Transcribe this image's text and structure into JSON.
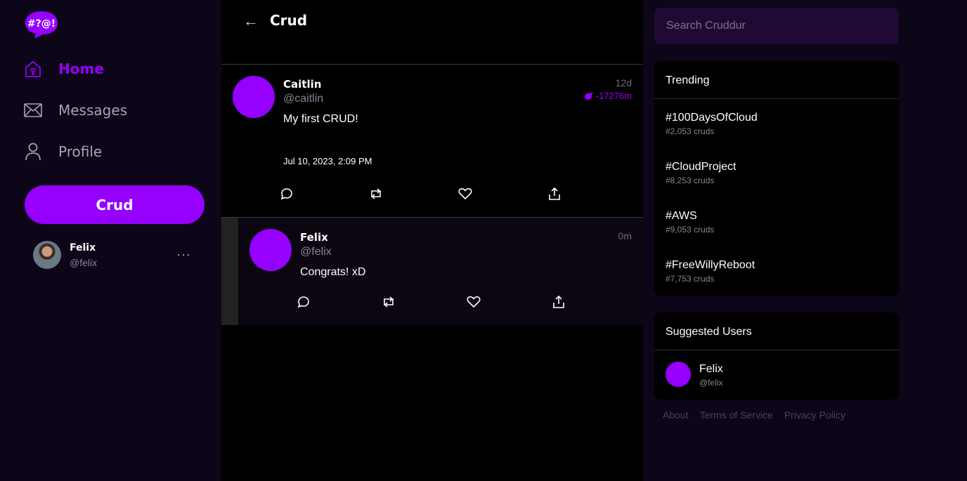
{
  "colors": {
    "accent": "#9500ff",
    "background": "#0d0518",
    "panel": "#000000"
  },
  "logo": {
    "text": "#?@!"
  },
  "nav": {
    "home": {
      "label": "Home",
      "icon": "home-icon"
    },
    "messages": {
      "label": "Messages",
      "icon": "mail-icon"
    },
    "profile": {
      "label": "Profile",
      "icon": "user-icon"
    }
  },
  "crud_button": {
    "label": "Crud"
  },
  "current_user": {
    "name": "Felix",
    "handle": "@felix",
    "more": "···"
  },
  "main": {
    "back": "←",
    "title": "Crud"
  },
  "post": {
    "name": "Caitlin",
    "handle": "@caitlin",
    "text": "My first CRUD!",
    "time": "12d",
    "expires": "-17276m",
    "date": "Jul 10, 2023, 2:09 PM"
  },
  "reply": {
    "name": "Felix",
    "handle": "@felix",
    "text": "Congrats! xD",
    "time": "0m"
  },
  "search": {
    "placeholder": "Search Cruddur"
  },
  "trending": {
    "title": "Trending",
    "items": [
      {
        "tag": "#100DaysOfCloud",
        "count": "#2,053 cruds"
      },
      {
        "tag": "#CloudProject",
        "count": "#8,253 cruds"
      },
      {
        "tag": "#AWS",
        "count": "#9,053 cruds"
      },
      {
        "tag": "#FreeWillyReboot",
        "count": "#7,753 cruds"
      }
    ]
  },
  "suggested": {
    "title": "Suggested Users",
    "users": [
      {
        "name": "Felix",
        "handle": "@felix"
      }
    ]
  },
  "footer": {
    "about": "About",
    "terms": "Terms of Service",
    "privacy": "Privacy Policy"
  }
}
